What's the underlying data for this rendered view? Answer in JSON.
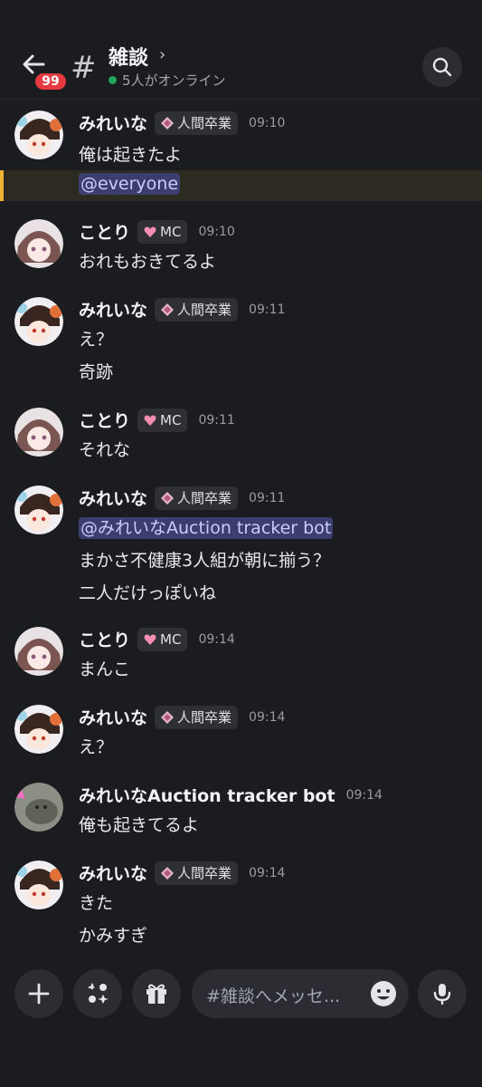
{
  "header": {
    "unread_badge": "99",
    "channel_name": "雑談",
    "chevron": "›",
    "online_text": "5人がオンライン"
  },
  "roles": {
    "mirena": "人間卒業",
    "kotori": "MC"
  },
  "messages": [
    {
      "author": "みれいな",
      "role": "人間卒業",
      "time": "09:10",
      "lines": [
        "俺は起きたよ"
      ],
      "mention": "@everyone"
    },
    {
      "author": "ことり",
      "role": "MC",
      "time": "09:10",
      "lines": [
        "おれもおきてるよ"
      ]
    },
    {
      "author": "みれいな",
      "role": "人間卒業",
      "time": "09:11",
      "lines": [
        "え？",
        "奇跡"
      ]
    },
    {
      "author": "ことり",
      "role": "MC",
      "time": "09:11",
      "lines": [
        "それな"
      ]
    },
    {
      "author": "みれいな",
      "role": "人間卒業",
      "time": "09:11",
      "mention": "@みれいなAuction tracker bot",
      "lines": [
        "まかさ不健康3人組が朝に揃う？",
        "二人だけっぽいね"
      ]
    },
    {
      "author": "ことり",
      "role": "MC",
      "time": "09:14",
      "lines": [
        "まんこ"
      ]
    },
    {
      "author": "みれいな",
      "role": "人間卒業",
      "time": "09:14",
      "lines": [
        "え？"
      ]
    },
    {
      "author": "みれいなAuction tracker bot",
      "time": "09:14",
      "lines": [
        "俺も起きてるよ"
      ]
    },
    {
      "author": "みれいな",
      "role": "人間卒業",
      "time": "09:14",
      "lines": [
        "きた",
        "かみすぎ"
      ]
    }
  ],
  "composer": {
    "placeholder": "#雑談へメッセ..."
  },
  "icons": {
    "back": "arrow-left-icon",
    "hash": "#",
    "search": "search-icon",
    "add": "plus-icon",
    "apps": "apps-icon",
    "gift": "gift-icon",
    "emoji": "emoji-icon",
    "mic": "microphone-icon"
  },
  "colors": {
    "background": "#1b1c20",
    "online": "#23a55a",
    "badge": "#e53b40",
    "mention_bg": "#3b3e6e",
    "mention_highlight": "#f0b232"
  }
}
